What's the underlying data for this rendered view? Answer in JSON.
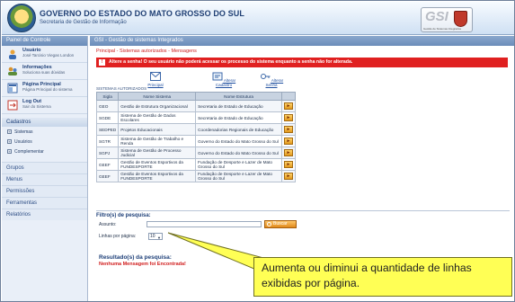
{
  "header": {
    "title": "GOVERNO DO ESTADO DO MATO GROSSO DO SUL",
    "subtitle": "Secretaria de Gestão de Informação",
    "logo_text": "GSI",
    "logo_caption": "Gestão de Sistemas Integrados"
  },
  "sidebar": {
    "panel_title": "Painel de Controle",
    "items": [
      {
        "title": "Usuário",
        "detail": "José Tarcisio Viegas London",
        "icon": "user-icon"
      },
      {
        "title": "Informações",
        "detail": "Soluciona suas dúvidas",
        "icon": "info-icon"
      },
      {
        "title": "Página Principal",
        "detail": "Página Principal do sistema",
        "icon": "home-icon"
      },
      {
        "title": "Log Out",
        "detail": "Sair do Sistema",
        "icon": "logout-icon"
      }
    ],
    "cadastros_title": "Cadastros",
    "cadastros": [
      "Sistemas",
      "Usuários",
      "Complementar"
    ],
    "menus": [
      "Grupos",
      "Menus",
      "Permissões",
      "Ferramentas",
      "Relatórios"
    ]
  },
  "main": {
    "title": "GSI - Gestão de sistemas Integrados",
    "breadcrumb": "Principal - Sistemas autorizados - Mensagens",
    "alert": "Altere a senha! O seu usuário não poderá acessar os processo do sistema enquanto a senha não for alterada.",
    "toolbar": {
      "principal": "Principal",
      "alterar_cadastro": "Alterar Cadastro",
      "alterar_senha": "Alterar Senha"
    },
    "systems_caption": "SISTEMAS AUTORIZADOS",
    "table_headers": [
      "Sigla",
      "Nome Sistema",
      "Nome Estrutura"
    ],
    "systems": [
      {
        "sigla": "GEO",
        "sistema": "Gestão de Estrutura Organizacional",
        "estrutura": "Secretaria de Estado de Educação"
      },
      {
        "sigla": "SGDE",
        "sistema": "Sistema de Gestão de Dados Escolares",
        "estrutura": "Secretaria de Estado de Educação"
      },
      {
        "sigla": "SEDPED",
        "sistema": "Projetos Educacionais",
        "estrutura": "Coordenadorias Regionais de Educação"
      },
      {
        "sigla": "SGTR",
        "sistema": "Sistema de Gestão de Trabalho e Renda",
        "estrutura": "Governo do Estado do Mato Grosso do Sul"
      },
      {
        "sigla": "SGPJ",
        "sistema": "Sistema de Gestão de Processo Judicial",
        "estrutura": "Governo do Estado do Mato Grosso do Sul"
      },
      {
        "sigla": "GEEF",
        "sistema": "Gestão de Eventos Esportivos da FUNDESPORTE",
        "estrutura": "Fundação de Desporte e Lazer de Mato Grosso do Sul"
      },
      {
        "sigla": "GEEF",
        "sistema": "Gestão de Eventos Esportivos da FUNDESPORTE",
        "estrutura": "Fundação de Desporte e Lazer de Mato Grosso do Sul"
      }
    ],
    "go_label": "►",
    "filter": {
      "title": "Filtro(s) de pesquisa:",
      "assunto_label": "Assunto:",
      "assunto_value": "",
      "search_label": "Buscar",
      "rows_label": "Linhas por página:",
      "rows_value": "10"
    },
    "result": {
      "title": "Resultado(s) da pesquisa:",
      "message": "Nenhuma Mensagem foi Encontrada!"
    }
  },
  "callout": {
    "text": "Aumenta ou diminui a quantidade de linhas exibidas por página."
  }
}
